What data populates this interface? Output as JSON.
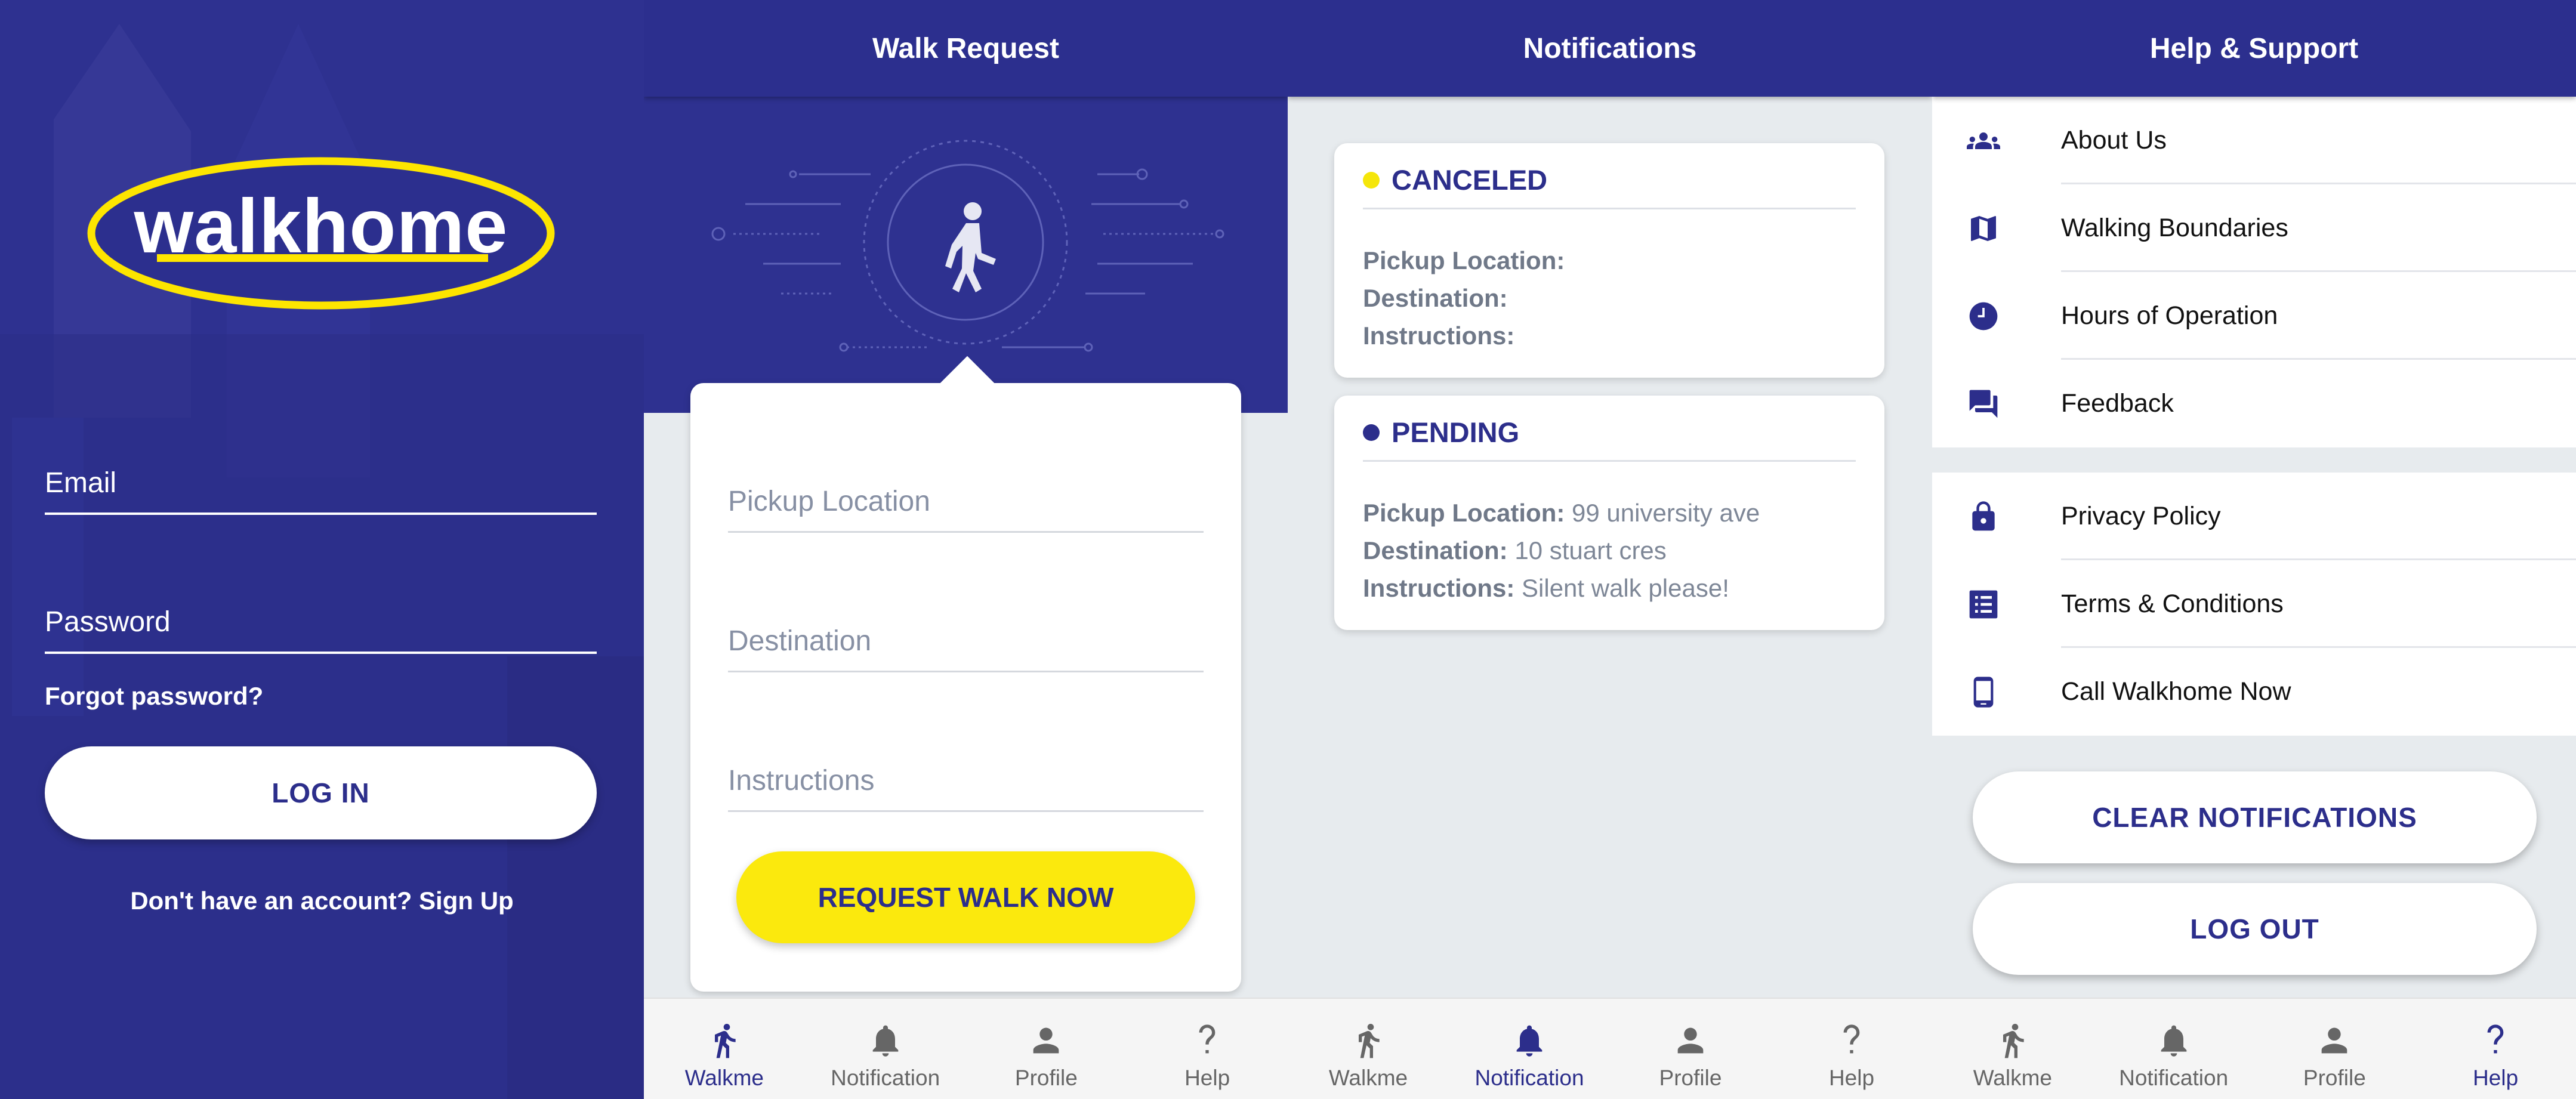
{
  "login": {
    "logo_text": "walkhome",
    "email_label": "Email",
    "password_label": "Password",
    "forgot": "Forgot password?",
    "login_button": "LOG IN",
    "signup_text": "Don't have an account? Sign Up"
  },
  "walk": {
    "title": "Walk Request",
    "pickup_placeholder": "Pickup Location",
    "destination_placeholder": "Destination",
    "instructions_placeholder": "Instructions",
    "request_button": "REQUEST WALK NOW"
  },
  "notifications": {
    "title": "Notifications",
    "items": [
      {
        "status": "CANCELED",
        "dot_color": "#f5e60a",
        "pickup_label": "Pickup Location:",
        "pickup_value": "",
        "destination_label": "Destination:",
        "destination_value": "",
        "instructions_label": "Instructions:",
        "instructions_value": ""
      },
      {
        "status": "PENDING",
        "dot_color": "#2c2e8b",
        "pickup_label": "Pickup Location:",
        "pickup_value": "99 university ave",
        "destination_label": "Destination:",
        "destination_value": "10 stuart cres",
        "instructions_label": "Instructions:",
        "instructions_value": "Silent walk please!"
      }
    ]
  },
  "help": {
    "title": "Help & Support",
    "group1": [
      {
        "label": "About Us",
        "icon": "group-icon"
      },
      {
        "label": "Walking Boundaries",
        "icon": "map-icon"
      },
      {
        "label": "Hours of Operation",
        "icon": "clock-icon"
      },
      {
        "label": "Feedback",
        "icon": "chat-icon"
      }
    ],
    "group2": [
      {
        "label": "Privacy Policy",
        "icon": "lock-icon"
      },
      {
        "label": "Terms & Conditions",
        "icon": "list-icon"
      },
      {
        "label": "Call Walkhome Now",
        "icon": "phone-icon"
      }
    ],
    "clear_button": "CLEAR NOTIFICATIONS",
    "logout_button": "LOG OUT"
  },
  "tabs": [
    {
      "label": "Walkme",
      "icon": "walker-icon"
    },
    {
      "label": "Notification",
      "icon": "bell-icon"
    },
    {
      "label": "Profile",
      "icon": "person-icon"
    },
    {
      "label": "Help",
      "icon": "question-icon"
    }
  ],
  "colors": {
    "brand": "#2c2f8e",
    "accent_yellow": "#fbe90d",
    "background": "#e7ebee",
    "tab_active": "#2c2e8b",
    "tab_inactive": "#666666"
  }
}
